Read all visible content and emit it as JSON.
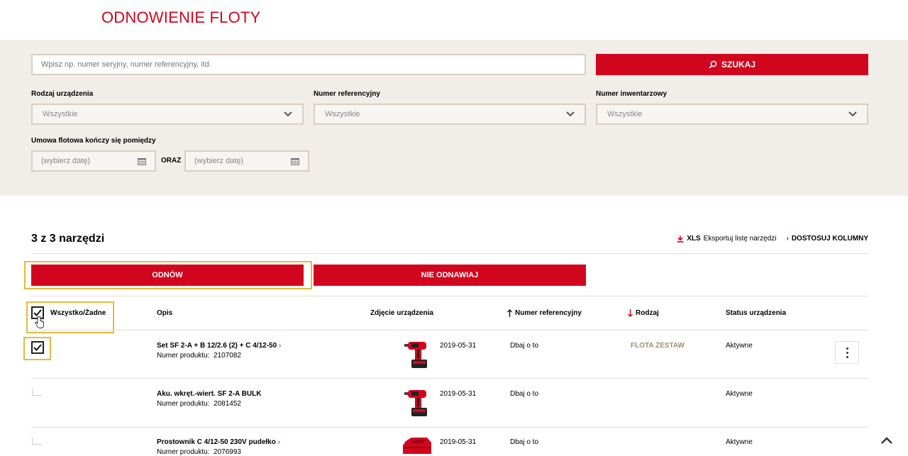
{
  "page": {
    "title": "ODNOWIENIE FLOTY"
  },
  "search": {
    "placeholder": "Wpisz np. numer seryjny, numer referencyjny, itd.",
    "button_label": "SZUKAJ"
  },
  "filters": {
    "device_type": {
      "label": "Rodzaj urządzenia",
      "value": "Wszystkie"
    },
    "reference_number": {
      "label": "Numer referencyjny",
      "value": "Wszystkie"
    },
    "inventory_number": {
      "label": "Numer inwentarzowy",
      "value": "Wszystkie"
    },
    "contract_end": {
      "label": "Umowa flotowa kończy się pomiędzy",
      "from_placeholder": "(wybierz datę)",
      "joiner": "ORAZ",
      "to_placeholder": "(wybierz datę)"
    }
  },
  "results": {
    "count_label": "3 z 3 narzędzi",
    "export_xls": "XLS",
    "export_label": "Eksportuj listę narzędzi",
    "adjust_columns": "DOSTOSUJ KOLUMNY"
  },
  "actions": {
    "renew": "ODNÓW",
    "do_not_renew": "NIE ODNAWIAJ"
  },
  "table": {
    "headers": {
      "select_all": "Wszystko/Żadne",
      "description": "Opis",
      "photo": "Zdjęcie urządzenia",
      "reference": "Numer referencyjny",
      "type": "Rodzaj",
      "status": "Status urządzenia"
    },
    "rows": [
      {
        "checked": true,
        "name": "Set SF 2-A + B 12/2.6 (2) + C 4/12-50",
        "has_link": true,
        "product_label": "Numer produktu:",
        "product_number": "2107082",
        "date": "2019-05-31",
        "reference": "Dbaj o to",
        "type": "FLOTA ZESTAW",
        "status": "Aktywne"
      },
      {
        "checked": false,
        "name": "Aku. wkręt.-wiert. SF 2-A BULK",
        "has_link": false,
        "product_label": "Numer produktu:",
        "product_number": "2081452",
        "date": "2019-05-31",
        "reference": "Dbaj o to",
        "type": "",
        "status": "Aktywne"
      },
      {
        "checked": false,
        "name": "Prostownik C 4/12-50 230V pudełko",
        "has_link": true,
        "product_label": "Numer produktu:",
        "product_number": "2076993",
        "date": "2019-05-31",
        "reference": "Dbaj o to",
        "type": "",
        "status": "Aktywne"
      }
    ]
  },
  "colors": {
    "accent": "#d2051e",
    "panel": "#f1eeea",
    "highlight": "#e6b93f",
    "fleet_tag": "#a08c6e"
  }
}
